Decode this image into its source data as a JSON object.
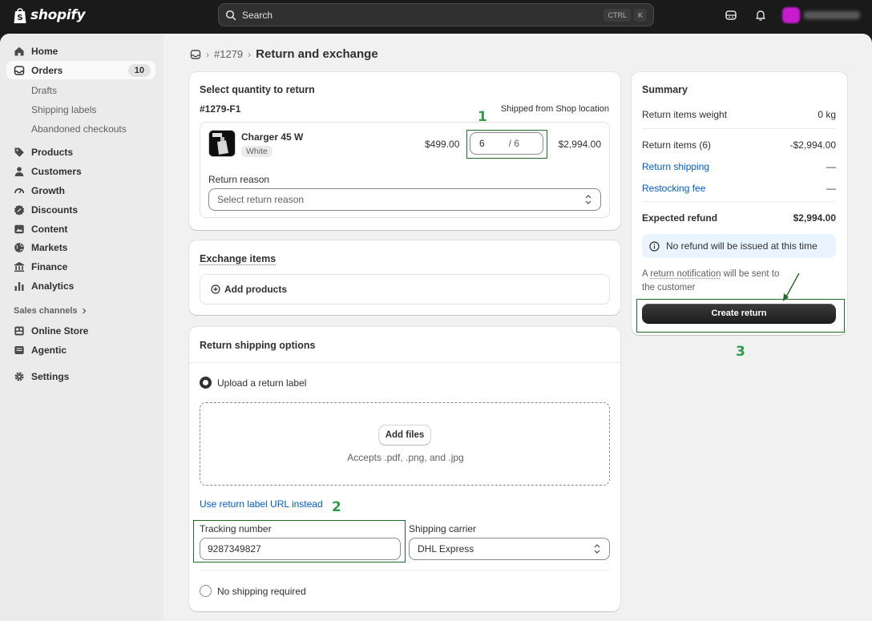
{
  "topbar": {
    "brand": "shopify",
    "search_placeholder": "Search",
    "shortcut_ctrl": "CTRL",
    "shortcut_key": "K"
  },
  "sidebar": {
    "home": "Home",
    "orders": "Orders",
    "orders_count": "10",
    "drafts": "Drafts",
    "shipping_labels": "Shipping labels",
    "abandoned": "Abandoned checkouts",
    "products": "Products",
    "customers": "Customers",
    "growth": "Growth",
    "discounts": "Discounts",
    "content": "Content",
    "markets": "Markets",
    "finance": "Finance",
    "analytics": "Analytics",
    "sales_channels": "Sales channels",
    "online_store": "Online Store",
    "agentic": "Agentic",
    "settings": "Settings"
  },
  "breadcrumb": {
    "order": "#1279",
    "title": "Return and exchange"
  },
  "return_card": {
    "title": "Select quantity to return",
    "fulfillment_id": "#1279-F1",
    "shipped_from": "Shipped from Shop location",
    "item_name": "Charger 45 W",
    "item_variant": "White",
    "unit_price": "$499.00",
    "qty_value": "6",
    "qty_total": "/ 6",
    "line_total": "$2,994.00",
    "reason_label": "Return reason",
    "reason_placeholder": "Select return reason"
  },
  "exchange_card": {
    "title": "Exchange items",
    "add_products": "Add products"
  },
  "shipping_card": {
    "title": "Return shipping options",
    "upload_label": "Upload a return label",
    "add_files": "Add files",
    "accepts": "Accepts .pdf, .png, and .jpg",
    "url_link": "Use return label URL instead",
    "tracking_label": "Tracking number",
    "tracking_value": "9287349827",
    "carrier_label": "Shipping carrier",
    "carrier_value": "DHL Express",
    "no_shipping": "No shipping required"
  },
  "summary": {
    "title": "Summary",
    "weight_label": "Return items weight",
    "weight_value": "0 kg",
    "items_label": "Return items (6)",
    "items_value": "-$2,994.00",
    "shipping_label": "Return shipping",
    "shipping_value": "—",
    "restocking_label": "Restocking fee",
    "restocking_value": "—",
    "refund_label": "Expected refund",
    "refund_value": "$2,994.00",
    "banner": "No refund will be issued at this time",
    "notify_prefix": "A",
    "notify_link": "return notification",
    "notify_suffix": "will be sent to",
    "notify_line2": "the customer",
    "create_button": "Create return"
  },
  "annotations": {
    "step1": "1",
    "step2": "2",
    "step3": "3",
    "color": "#2e9b4a"
  }
}
